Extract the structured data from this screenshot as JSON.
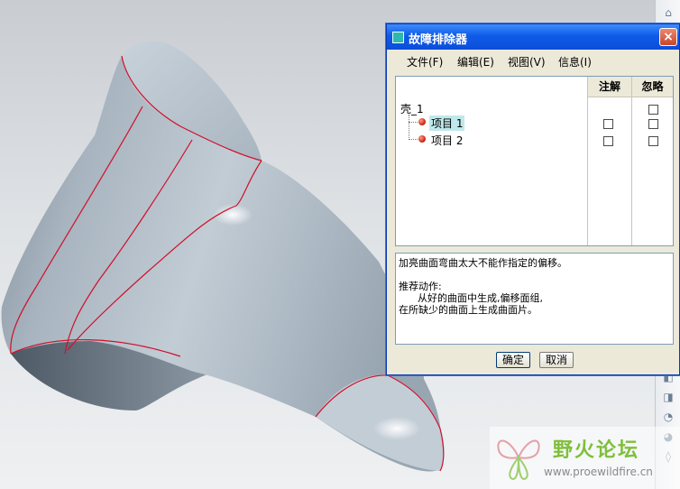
{
  "dialog": {
    "title": "故障排除器",
    "close_label": "×",
    "menu": [
      "文件(F)",
      "编辑(E)",
      "视图(V)",
      "信息(I)"
    ],
    "columns": [
      "注解",
      "忽略"
    ],
    "tree": {
      "root": "壳_1",
      "items": [
        {
          "label": "项目 1",
          "selected": true,
          "note_checked": false,
          "ignore_checked": false
        },
        {
          "label": "项目 2",
          "selected": false,
          "note_checked": false,
          "ignore_checked": false
        }
      ]
    },
    "message": {
      "error": "加亮曲面弯曲太大不能作指定的偏移。",
      "heading": "推荐动作:",
      "action_1": "      从好的曲面中生成,偏移面组,",
      "action_2": "在所缺少的曲面上生成曲面片。"
    },
    "buttons": {
      "ok": "确定",
      "cancel": "取消"
    }
  },
  "watermark": {
    "title": "野火论坛",
    "url": "www.proewildfire.cn"
  },
  "colors": {
    "model_surface": "#a9b6c2",
    "edge_highlight": "#d0102a",
    "titlebar": "#0a4ed8"
  },
  "icons": [
    "dialog-app-icon",
    "close-icon",
    "error-dot-icon",
    "toolbar-icons",
    "butterfly-logo-icon"
  ]
}
